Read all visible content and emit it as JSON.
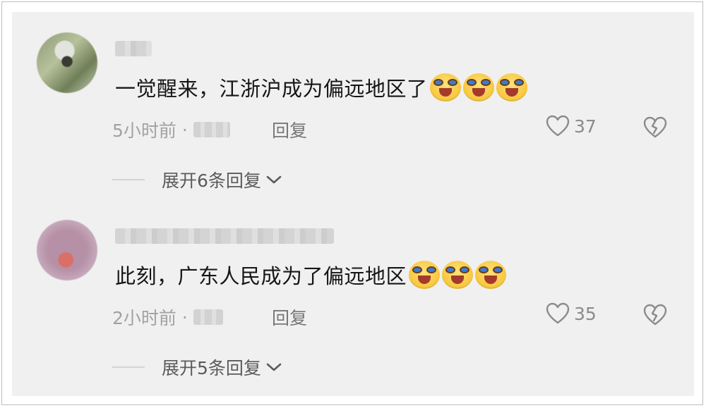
{
  "comments": [
    {
      "username": "",
      "text": "一觉醒来，江浙沪成为偏远地区了",
      "emojis": [
        "crying-laughing-emoji",
        "crying-laughing-emoji",
        "crying-laughing-emoji"
      ],
      "time": "5小时前",
      "dot": "·",
      "location": "",
      "reply_label": "回复",
      "likes": "37",
      "expand_label": "展开6条回复"
    },
    {
      "username": "",
      "text": "此刻，广东人民成为了偏远地区",
      "emojis": [
        "crying-laughing-emoji",
        "crying-laughing-emoji",
        "crying-laughing-emoji"
      ],
      "time": "2小时前",
      "dot": "·",
      "location": "",
      "reply_label": "回复",
      "likes": "35",
      "expand_label": "展开5条回复"
    }
  ],
  "colors": {
    "panel_bg": "#f0f0f0",
    "text": "#161616",
    "meta_text": "#a2a2a2",
    "reply_text": "#777777",
    "icon": "#8b8b8b"
  },
  "icons": {
    "like": "heart-outline-icon",
    "dislike": "broken-heart-icon",
    "expand": "chevron-down-icon"
  }
}
